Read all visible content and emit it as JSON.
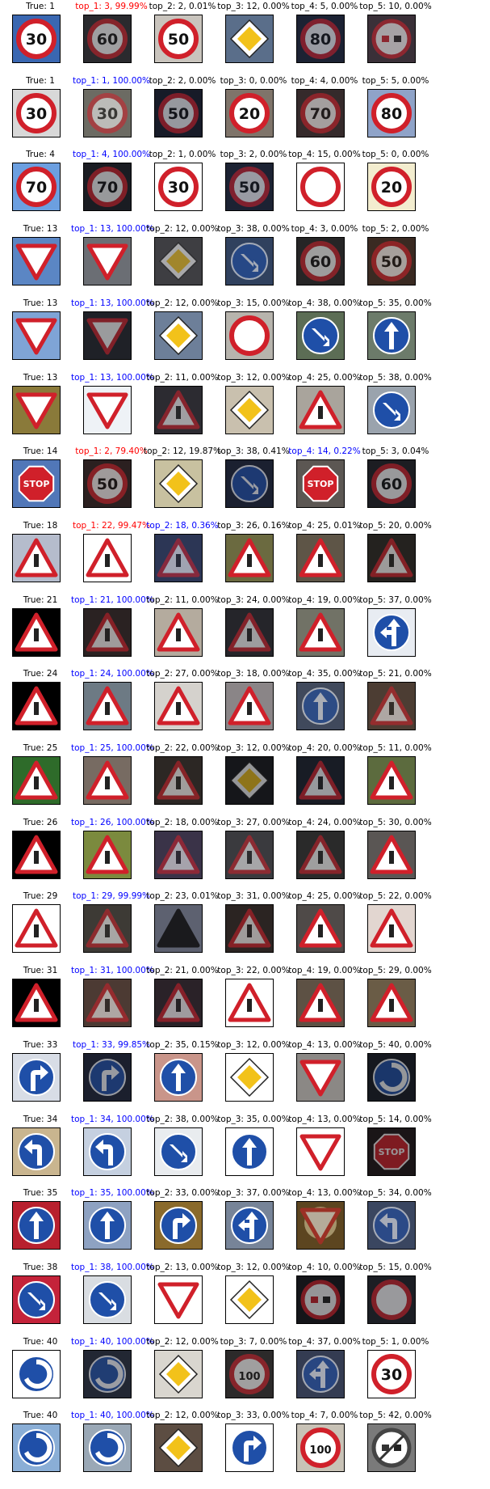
{
  "rows": [
    {
      "true_label": "True: 1",
      "preds": [
        {
          "text": "top_1: 3, 99.99%",
          "color": "red",
          "sign": "speed60",
          "bg": "#2a2a2e",
          "dark": true
        },
        {
          "text": "top_2: 2, 0.01%",
          "color": "black",
          "sign": "speed50",
          "bg": "#c9c4bd",
          "dark": false
        },
        {
          "text": "top_3: 12, 0.00%",
          "color": "black",
          "sign": "diamond",
          "bg": "#5a6e8a",
          "dark": false
        },
        {
          "text": "top_4: 5, 0.00%",
          "color": "black",
          "sign": "speed80",
          "bg": "#1c2233",
          "dark": true
        },
        {
          "text": "top_5: 10, 0.00%",
          "color": "black",
          "sign": "nopass",
          "bg": "#3a3038",
          "dark": true
        }
      ],
      "true_sign": "speed30",
      "true_bg": "#3a67b1"
    },
    {
      "true_label": "True: 1",
      "preds": [
        {
          "text": "top_1: 1, 100.00%",
          "color": "blue",
          "sign": "speed30",
          "bg": "#6c6b63",
          "dark": true
        },
        {
          "text": "top_2: 2, 0.00%",
          "color": "black",
          "sign": "speed50",
          "bg": "#171b28",
          "dark": true
        },
        {
          "text": "top_3: 0, 0.00%",
          "color": "black",
          "sign": "speed20",
          "bg": "#7f746a",
          "dark": false
        },
        {
          "text": "top_4: 4, 0.00%",
          "color": "black",
          "sign": "speed70",
          "bg": "#352a2b",
          "dark": true
        },
        {
          "text": "top_5: 5, 0.00%",
          "color": "black",
          "sign": "speed80",
          "bg": "#8fa3c8",
          "dark": false
        }
      ],
      "true_sign": "speed30",
      "true_bg": "#d8d8d8"
    },
    {
      "true_label": "True: 4",
      "preds": [
        {
          "text": "top_1: 4, 100.00%",
          "color": "blue",
          "sign": "speed70",
          "bg": "#1a1c22",
          "dark": true
        },
        {
          "text": "top_2: 1, 0.00%",
          "color": "black",
          "sign": "speed30",
          "bg": "#ffffff",
          "dark": false
        },
        {
          "text": "top_3: 2, 0.00%",
          "color": "black",
          "sign": "speed50",
          "bg": "#1c2233",
          "dark": true
        },
        {
          "text": "top_4: 15, 0.00%",
          "color": "black",
          "sign": "novehicle",
          "bg": "#ffffff",
          "dark": false
        },
        {
          "text": "top_5: 0, 0.00%",
          "color": "black",
          "sign": "speed20",
          "bg": "#f3edcf",
          "dark": false
        }
      ],
      "true_sign": "speed70",
      "true_bg": "#6c9fe0"
    },
    {
      "true_label": "True: 13",
      "preds": [
        {
          "text": "top_1: 13, 100.00%",
          "color": "blue",
          "sign": "yield",
          "bg": "#6b6e74",
          "dark": false
        },
        {
          "text": "top_2: 12, 0.00%",
          "color": "black",
          "sign": "diamond",
          "bg": "#3e3e42",
          "dark": true
        },
        {
          "text": "top_3: 38, 0.00%",
          "color": "black",
          "sign": "keepright",
          "bg": "#30415e",
          "dark": true
        },
        {
          "text": "top_4: 3, 0.00%",
          "color": "black",
          "sign": "speed60",
          "bg": "#262526",
          "dark": true
        },
        {
          "text": "top_5: 2, 0.00%",
          "color": "black",
          "sign": "speed50",
          "bg": "#3a2a22",
          "dark": true
        }
      ],
      "true_sign": "yield",
      "true_bg": "#5b86c4"
    },
    {
      "true_label": "True: 13",
      "preds": [
        {
          "text": "top_1: 13, 100.00%",
          "color": "blue",
          "sign": "yield",
          "bg": "#1f2127",
          "dark": true
        },
        {
          "text": "top_2: 12, 0.00%",
          "color": "black",
          "sign": "diamond",
          "bg": "#6d7f99",
          "dark": false
        },
        {
          "text": "top_3: 15, 0.00%",
          "color": "black",
          "sign": "novehicle",
          "bg": "#b7b4ad",
          "dark": false
        },
        {
          "text": "top_4: 38, 0.00%",
          "color": "black",
          "sign": "keepright",
          "bg": "#5c6d55",
          "dark": false
        },
        {
          "text": "top_5: 35, 0.00%",
          "color": "black",
          "sign": "ahead",
          "bg": "#6c7b6a",
          "dark": false
        }
      ],
      "true_sign": "yield",
      "true_bg": "#7fa4d6"
    },
    {
      "true_label": "True: 13",
      "preds": [
        {
          "text": "top_1: 13, 100.00%",
          "color": "blue",
          "sign": "yield",
          "bg": "#eef2f6",
          "dark": false
        },
        {
          "text": "top_2: 11, 0.00%",
          "color": "black",
          "sign": "warning",
          "bg": "#2c2b31",
          "dark": true
        },
        {
          "text": "top_3: 12, 0.00%",
          "color": "black",
          "sign": "diamond",
          "bg": "#c9c0ae",
          "dark": false
        },
        {
          "text": "top_4: 25, 0.00%",
          "color": "black",
          "sign": "warning",
          "bg": "#a9a49c",
          "dark": false
        },
        {
          "text": "top_5: 38, 0.00%",
          "color": "black",
          "sign": "keepright",
          "bg": "#9aa3ad",
          "dark": false
        }
      ],
      "true_sign": "yield",
      "true_bg": "#8a7a3a"
    },
    {
      "true_label": "True: 14",
      "preds": [
        {
          "text": "top_1: 2, 79.40%",
          "color": "red",
          "sign": "speed50",
          "bg": "#2b2020",
          "dark": true
        },
        {
          "text": "top_2: 12, 19.87%",
          "color": "black",
          "sign": "diamond",
          "bg": "#c8c1a0",
          "dark": false
        },
        {
          "text": "top_3: 38, 0.41%",
          "color": "black",
          "sign": "keepright",
          "bg": "#1b2030",
          "dark": true
        },
        {
          "text": "top_4: 14, 0.22%",
          "color": "blue",
          "sign": "stop",
          "bg": "#5c5753",
          "dark": false
        },
        {
          "text": "top_5: 3, 0.04%",
          "color": "black",
          "sign": "speed60",
          "bg": "#1c1d22",
          "dark": true
        }
      ],
      "true_sign": "stop",
      "true_bg": "#5177b8"
    },
    {
      "true_label": "True: 18",
      "preds": [
        {
          "text": "top_1: 22, 99.47%",
          "color": "red",
          "sign": "warning",
          "bg": "#ffffff",
          "dark": false
        },
        {
          "text": "top_2: 18, 0.36%",
          "color": "blue",
          "sign": "warning",
          "bg": "#2c3655",
          "dark": true
        },
        {
          "text": "top_3: 26, 0.16%",
          "color": "black",
          "sign": "warning",
          "bg": "#6b6a40",
          "dark": false
        },
        {
          "text": "top_4: 25, 0.01%",
          "color": "black",
          "sign": "warning",
          "bg": "#5e5547",
          "dark": false
        },
        {
          "text": "top_5: 20, 0.00%",
          "color": "black",
          "sign": "warning",
          "bg": "#24221f",
          "dark": true
        }
      ],
      "true_sign": "warning",
      "true_bg": "#b5bccc"
    },
    {
      "true_label": "True: 21",
      "preds": [
        {
          "text": "top_1: 21, 100.00%",
          "color": "blue",
          "sign": "warning",
          "bg": "#2a2222",
          "dark": true
        },
        {
          "text": "top_2: 11, 0.00%",
          "color": "black",
          "sign": "warning",
          "bg": "#b4ab9e",
          "dark": false
        },
        {
          "text": "top_3: 24, 0.00%",
          "color": "black",
          "sign": "warning",
          "bg": "#25252a",
          "dark": true
        },
        {
          "text": "top_4: 19, 0.00%",
          "color": "black",
          "sign": "warning",
          "bg": "#717266",
          "dark": false
        },
        {
          "text": "top_5: 37, 0.00%",
          "color": "black",
          "sign": "aheadleft",
          "bg": "#e8ecf2",
          "dark": false
        }
      ],
      "true_sign": "warning",
      "true_bg": "#000000"
    },
    {
      "true_label": "True: 24",
      "preds": [
        {
          "text": "top_1: 24, 100.00%",
          "color": "blue",
          "sign": "warning",
          "bg": "#6d7a84",
          "dark": false
        },
        {
          "text": "top_2: 27, 0.00%",
          "color": "black",
          "sign": "warning",
          "bg": "#d5d2cd",
          "dark": false
        },
        {
          "text": "top_3: 18, 0.00%",
          "color": "black",
          "sign": "warning",
          "bg": "#8a8587",
          "dark": false
        },
        {
          "text": "top_4: 35, 0.00%",
          "color": "black",
          "sign": "ahead",
          "bg": "#40495c",
          "dark": true
        },
        {
          "text": "top_5: 21, 0.00%",
          "color": "black",
          "sign": "warning",
          "bg": "#4c3d33",
          "dark": true
        }
      ],
      "true_sign": "warning",
      "true_bg": "#000000"
    },
    {
      "true_label": "True: 25",
      "preds": [
        {
          "text": "top_1: 25, 100.00%",
          "color": "blue",
          "sign": "warning",
          "bg": "#776b62",
          "dark": false
        },
        {
          "text": "top_2: 22, 0.00%",
          "color": "black",
          "sign": "warning",
          "bg": "#2c2724",
          "dark": true
        },
        {
          "text": "top_3: 12, 0.00%",
          "color": "black",
          "sign": "diamond",
          "bg": "#15161a",
          "dark": true
        },
        {
          "text": "top_4: 20, 0.00%",
          "color": "black",
          "sign": "warning",
          "bg": "#181c25",
          "dark": true
        },
        {
          "text": "top_5: 11, 0.00%",
          "color": "black",
          "sign": "warning",
          "bg": "#5c6b3e",
          "dark": false
        }
      ],
      "true_sign": "warning",
      "true_bg": "#2e6b2a"
    },
    {
      "true_label": "True: 26",
      "preds": [
        {
          "text": "top_1: 26, 100.00%",
          "color": "blue",
          "sign": "warning",
          "bg": "#7b8a3e",
          "dark": false
        },
        {
          "text": "top_2: 18, 0.00%",
          "color": "black",
          "sign": "warning",
          "bg": "#3a3348",
          "dark": true
        },
        {
          "text": "top_3: 27, 0.00%",
          "color": "black",
          "sign": "warning",
          "bg": "#3a3a3e",
          "dark": true
        },
        {
          "text": "top_4: 24, 0.00%",
          "color": "black",
          "sign": "warning",
          "bg": "#2a2a2a",
          "dark": true
        },
        {
          "text": "top_5: 30, 0.00%",
          "color": "black",
          "sign": "warning",
          "bg": "#5a5654",
          "dark": false
        }
      ],
      "true_sign": "warning",
      "true_bg": "#000000"
    },
    {
      "true_label": "True: 29",
      "preds": [
        {
          "text": "top_1: 29, 99.99%",
          "color": "blue",
          "sign": "warning",
          "bg": "#3d3a35",
          "dark": true
        },
        {
          "text": "top_2: 23, 0.01%",
          "color": "black",
          "sign": "darktri",
          "bg": "#5d6170",
          "dark": false
        },
        {
          "text": "top_3: 31, 0.00%",
          "color": "black",
          "sign": "warning",
          "bg": "#2b2422",
          "dark": true
        },
        {
          "text": "top_4: 25, 0.00%",
          "color": "black",
          "sign": "warning",
          "bg": "#4f4a48",
          "dark": false
        },
        {
          "text": "top_5: 22, 0.00%",
          "color": "black",
          "sign": "warning",
          "bg": "#e2d6d0",
          "dark": false
        }
      ],
      "true_sign": "warning",
      "true_bg": "#ffffff"
    },
    {
      "true_label": "True: 31",
      "preds": [
        {
          "text": "top_1: 31, 100.00%",
          "color": "blue",
          "sign": "warning",
          "bg": "#4c3a33",
          "dark": true
        },
        {
          "text": "top_2: 21, 0.00%",
          "color": "black",
          "sign": "warning",
          "bg": "#2a2228",
          "dark": true
        },
        {
          "text": "top_3: 22, 0.00%",
          "color": "black",
          "sign": "warning",
          "bg": "#ffffff",
          "dark": false
        },
        {
          "text": "top_4: 19, 0.00%",
          "color": "black",
          "sign": "warning",
          "bg": "#5d5144",
          "dark": false
        },
        {
          "text": "top_5: 29, 0.00%",
          "color": "black",
          "sign": "warning",
          "bg": "#6a5c46",
          "dark": false
        }
      ],
      "true_sign": "warning",
      "true_bg": "#000000"
    },
    {
      "true_label": "True: 33",
      "preds": [
        {
          "text": "top_1: 33, 99.85%",
          "color": "blue",
          "sign": "turnright",
          "bg": "#1b1f2d",
          "dark": true
        },
        {
          "text": "top_2: 35, 0.15%",
          "color": "black",
          "sign": "ahead",
          "bg": "#c9958a",
          "dark": false
        },
        {
          "text": "top_3: 12, 0.00%",
          "color": "black",
          "sign": "diamond",
          "bg": "#ffffff",
          "dark": false
        },
        {
          "text": "top_4: 13, 0.00%",
          "color": "black",
          "sign": "yield",
          "bg": "#8b8885",
          "dark": false
        },
        {
          "text": "top_5: 40, 0.00%",
          "color": "black",
          "sign": "roundabout",
          "bg": "#15181f",
          "dark": true
        }
      ],
      "true_sign": "turnright",
      "true_bg": "#d8dde6"
    },
    {
      "true_label": "True: 34",
      "preds": [
        {
          "text": "top_1: 34, 100.00%",
          "color": "blue",
          "sign": "turnleft",
          "bg": "#c5d0e0",
          "dark": false
        },
        {
          "text": "top_2: 38, 0.00%",
          "color": "black",
          "sign": "keepright",
          "bg": "#e9ecef",
          "dark": false
        },
        {
          "text": "top_3: 35, 0.00%",
          "color": "black",
          "sign": "ahead",
          "bg": "#ffffff",
          "dark": false
        },
        {
          "text": "top_4: 13, 0.00%",
          "color": "black",
          "sign": "yield",
          "bg": "#ffffff",
          "dark": false
        },
        {
          "text": "top_5: 14, 0.00%",
          "color": "black",
          "sign": "stop",
          "bg": "#1a1517",
          "dark": true
        }
      ],
      "true_sign": "turnleft",
      "true_bg": "#c9b58f"
    },
    {
      "true_label": "True: 35",
      "preds": [
        {
          "text": "top_1: 35, 100.00%",
          "color": "blue",
          "sign": "ahead",
          "bg": "#8ea2c2",
          "dark": false
        },
        {
          "text": "top_2: 33, 0.00%",
          "color": "black",
          "sign": "turnright",
          "bg": "#8a6a2c",
          "dark": false
        },
        {
          "text": "top_3: 37, 0.00%",
          "color": "black",
          "sign": "aheadleft",
          "bg": "#778498",
          "dark": false
        },
        {
          "text": "top_4: 13, 0.00%",
          "color": "black",
          "sign": "yieldglow",
          "bg": "#5c4520",
          "dark": true
        },
        {
          "text": "top_5: 34, 0.00%",
          "color": "black",
          "sign": "turnleft",
          "bg": "#3a4660",
          "dark": true
        }
      ],
      "true_sign": "ahead",
      "true_bg": "#b8202e"
    },
    {
      "true_label": "True: 38",
      "preds": [
        {
          "text": "top_1: 38, 100.00%",
          "color": "blue",
          "sign": "keepright",
          "bg": "#d9dde2",
          "dark": false
        },
        {
          "text": "top_2: 13, 0.00%",
          "color": "black",
          "sign": "yield",
          "bg": "#ffffff",
          "dark": false
        },
        {
          "text": "top_3: 12, 0.00%",
          "color": "black",
          "sign": "diamond",
          "bg": "#ffffff",
          "dark": false
        },
        {
          "text": "top_4: 10, 0.00%",
          "color": "black",
          "sign": "nopass",
          "bg": "#141519",
          "dark": true
        },
        {
          "text": "top_5: 15, 0.00%",
          "color": "black",
          "sign": "novehicle",
          "bg": "#1c1e24",
          "dark": true
        }
      ],
      "true_sign": "keepright",
      "true_bg": "#c4233a"
    },
    {
      "true_label": "True: 40",
      "preds": [
        {
          "text": "top_1: 40, 100.00%",
          "color": "blue",
          "sign": "roundabout",
          "bg": "#222733",
          "dark": true
        },
        {
          "text": "top_2: 12, 0.00%",
          "color": "black",
          "sign": "diamond",
          "bg": "#d9d6cf",
          "dark": false
        },
        {
          "text": "top_3: 7, 0.00%",
          "color": "black",
          "sign": "speed100",
          "bg": "#2c2a2a",
          "dark": true
        },
        {
          "text": "top_4: 37, 0.00%",
          "color": "black",
          "sign": "aheadleft",
          "bg": "#343c52",
          "dark": true
        },
        {
          "text": "top_5: 1, 0.00%",
          "color": "black",
          "sign": "speed30",
          "bg": "#ffffff",
          "dark": false
        }
      ],
      "true_sign": "roundabout",
      "true_bg": "#ffffff"
    },
    {
      "true_label": "True: 40",
      "preds": [
        {
          "text": "top_1: 40, 100.00%",
          "color": "blue",
          "sign": "roundabout",
          "bg": "#9aa8b6",
          "dark": false
        },
        {
          "text": "top_2: 12, 0.00%",
          "color": "black",
          "sign": "diamond",
          "bg": "#5c4d42",
          "dark": false
        },
        {
          "text": "top_3: 33, 0.00%",
          "color": "black",
          "sign": "turnright",
          "bg": "#ffffff",
          "dark": false
        },
        {
          "text": "top_4: 7, 0.00%",
          "color": "black",
          "sign": "speed100",
          "bg": "#c8c2b6",
          "dark": false
        },
        {
          "text": "top_5: 42, 0.00%",
          "color": "black",
          "sign": "endnopass",
          "bg": "#7a7a7a",
          "dark": false
        }
      ],
      "true_sign": "roundabout",
      "true_bg": "#8aaed6"
    }
  ],
  "sign_text": {
    "speed30": "30",
    "speed50": "50",
    "speed60": "60",
    "speed70": "70",
    "speed80": "80",
    "speed20": "20",
    "speed100": "100",
    "stop": "STOP"
  },
  "colors": {
    "correct": "#0000ff",
    "wrong": "#ff0000",
    "default": "#000000",
    "sign_red": "#d0202a",
    "sign_blue": "#1f4fa8",
    "sign_yellow": "#f2c21a"
  }
}
